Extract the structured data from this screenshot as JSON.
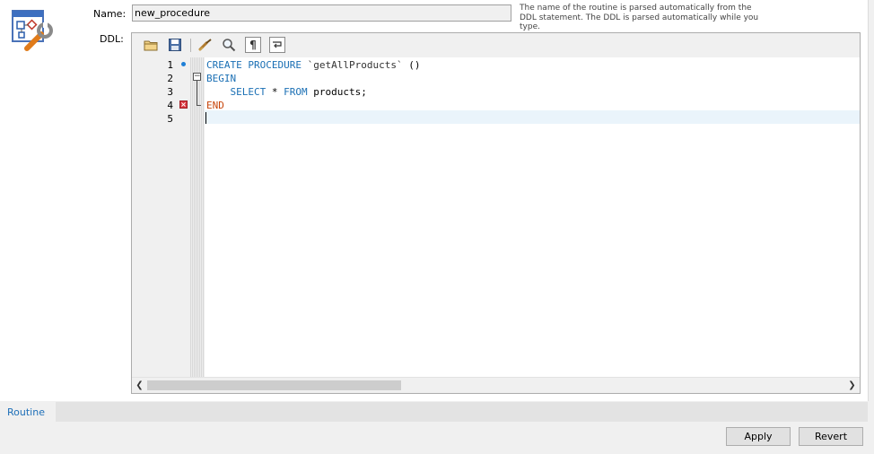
{
  "form": {
    "name_label": "Name:",
    "name_value": "new_procedure",
    "ddl_label": "DDL:",
    "hint": "The name of the routine is parsed automatically from the DDL statement. The DDL is parsed automatically while you type."
  },
  "toolbar": {
    "icons": [
      "open-folder-icon",
      "save-icon",
      "beautify-brush-icon",
      "find-magnifier-icon",
      "pilcrow-icon",
      "word-wrap-icon"
    ]
  },
  "editor": {
    "line_numbers": [
      "1",
      "2",
      "3",
      "4",
      "5"
    ],
    "lines": {
      "l1": {
        "kw1": "CREATE",
        "kw2": "PROCEDURE",
        "ident": "`getAllProducts`",
        "parens": "()"
      },
      "l2": {
        "kw": "BEGIN"
      },
      "l3": {
        "indent": "    ",
        "kw1": "SELECT",
        "mid": " * ",
        "kw2": "FROM",
        "rest": " products;"
      },
      "l4": {
        "kw": "END"
      }
    },
    "markers": {
      "line1": "statement-dot",
      "line4": "error-icon"
    },
    "colors": {
      "keyword": "#1a6fb4",
      "end_keyword": "#c7450a",
      "current_line": "#eaf4fb"
    }
  },
  "tabs": {
    "routine": "Routine"
  },
  "buttons": {
    "apply": "Apply",
    "revert": "Revert"
  }
}
